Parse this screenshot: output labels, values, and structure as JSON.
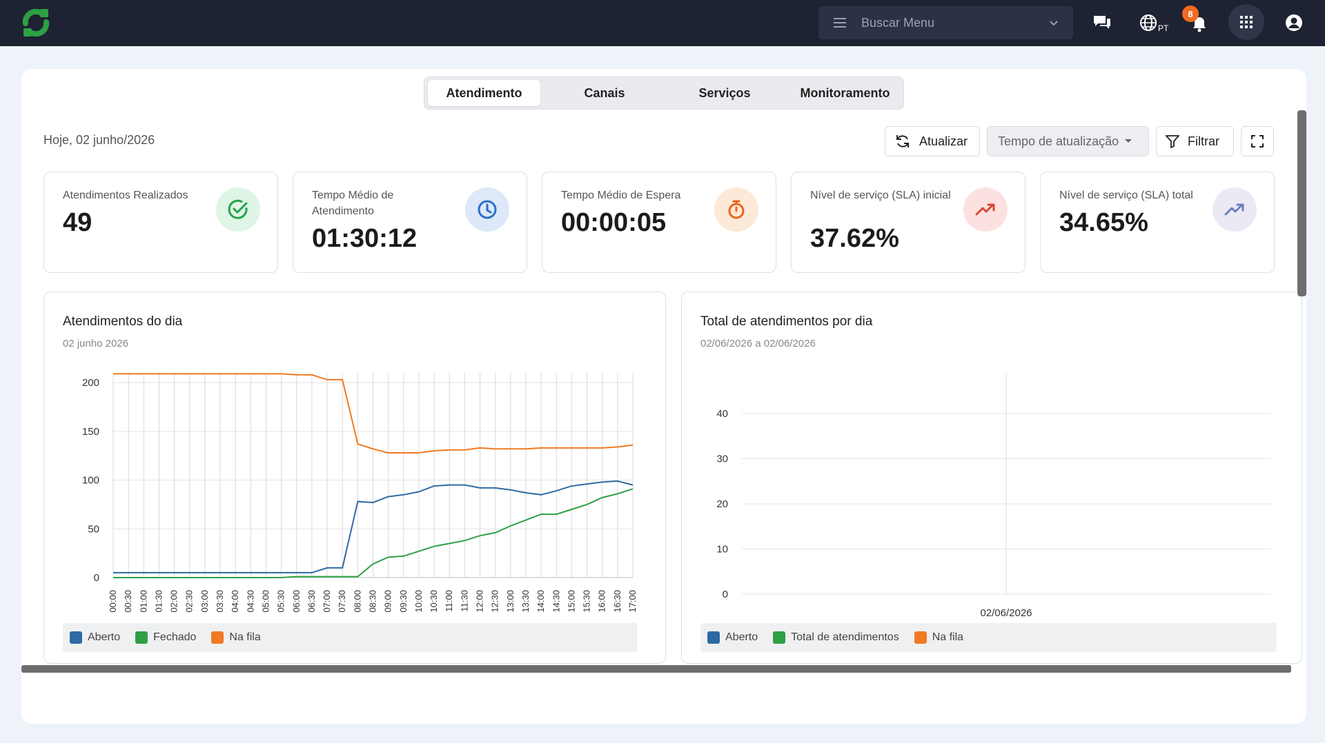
{
  "header": {
    "search_placeholder": "Buscar Menu",
    "lang": "PT",
    "notification_count": "8"
  },
  "tabs": [
    {
      "label": "Atendimento",
      "active": true
    },
    {
      "label": "Canais",
      "active": false
    },
    {
      "label": "Serviços",
      "active": false
    },
    {
      "label": "Monitoramento",
      "active": false
    }
  ],
  "toolbar": {
    "date": "Hoje, 02 junho/2026",
    "refresh_label": "Atualizar",
    "interval_label": "Tempo de atualização",
    "filter_label": "Filtrar"
  },
  "kpis": [
    {
      "label": "Atendimentos Realizados",
      "value": "49",
      "icon": "check-circle-icon",
      "color": "#22a34a"
    },
    {
      "label": "Tempo Médio de Atendimento",
      "value": "01:30:12",
      "icon": "clock-icon",
      "color": "#2a6fc9"
    },
    {
      "label": "Tempo Médio de Espera",
      "value": "00:00:05",
      "icon": "stopwatch-icon",
      "color": "#e8641f"
    },
    {
      "label": "Nível de serviço (SLA) inicial",
      "value": "37.62%",
      "icon": "trending-up-icon",
      "color": "#d9463a"
    },
    {
      "label": "Nível de serviço (SLA) total",
      "value": "34.65%",
      "icon": "trending-up-icon",
      "color": "#6b7fc4"
    }
  ],
  "colors": {
    "aberto": "#2d6aa3",
    "fechado": "#2ea043",
    "fila": "#f07a22"
  },
  "chart_data": [
    {
      "type": "line",
      "title": "Atendimentos do dia",
      "subtitle": "02 junho 2026",
      "ylim": [
        0,
        210
      ],
      "yticks": [
        0,
        50,
        100,
        150,
        200
      ],
      "grid": true,
      "legend_position": "bottom",
      "x": [
        "00:00",
        "00:30",
        "01:00",
        "01:30",
        "02:00",
        "02:30",
        "03:00",
        "03:30",
        "04:00",
        "04:30",
        "05:00",
        "05:30",
        "06:00",
        "06:30",
        "07:00",
        "07:30",
        "08:00",
        "08:30",
        "09:00",
        "09:30",
        "10:00",
        "10:30",
        "11:00",
        "11:30",
        "12:00",
        "12:30",
        "13:00",
        "13:30",
        "14:00",
        "14:30",
        "15:00",
        "15:30",
        "16:00",
        "16:30",
        "17:00"
      ],
      "series": [
        {
          "name": "Aberto",
          "color": "#2d6aa3",
          "values": [
            5,
            5,
            5,
            5,
            5,
            5,
            5,
            5,
            5,
            5,
            5,
            5,
            5,
            5,
            10,
            10,
            78,
            77,
            83,
            85,
            88,
            94,
            95,
            95,
            92,
            92,
            90,
            87,
            85,
            89,
            94,
            96,
            98,
            99,
            95
          ]
        },
        {
          "name": "Fechado",
          "color": "#2ea043",
          "values": [
            0,
            0,
            0,
            0,
            0,
            0,
            0,
            0,
            0,
            0,
            0,
            0,
            1,
            1,
            1,
            1,
            1,
            14,
            21,
            22,
            27,
            32,
            35,
            38,
            43,
            46,
            53,
            59,
            65,
            65,
            70,
            75,
            82,
            86,
            91
          ]
        },
        {
          "name": "Na fila",
          "color": "#f07a22",
          "values": [
            209,
            209,
            209,
            209,
            209,
            209,
            209,
            209,
            209,
            209,
            209,
            209,
            208,
            208,
            203,
            203,
            137,
            132,
            128,
            128,
            128,
            130,
            131,
            131,
            133,
            132,
            132,
            132,
            133,
            133,
            133,
            133,
            133,
            134,
            136
          ]
        }
      ]
    },
    {
      "type": "line",
      "title": "Total de atendimentos por dia",
      "subtitle": "02/06/2026 a 02/06/2026",
      "ylim": [
        0,
        49
      ],
      "yticks": [
        0,
        10,
        20,
        30,
        40
      ],
      "grid": true,
      "legend_position": "bottom",
      "x": [
        "02/06/2026"
      ],
      "series": [
        {
          "name": "Aberto",
          "color": "#2d6aa3",
          "values": []
        },
        {
          "name": "Total de atendimentos",
          "color": "#2ea043",
          "values": []
        },
        {
          "name": "Na fila",
          "color": "#f07a22",
          "values": []
        }
      ]
    }
  ]
}
